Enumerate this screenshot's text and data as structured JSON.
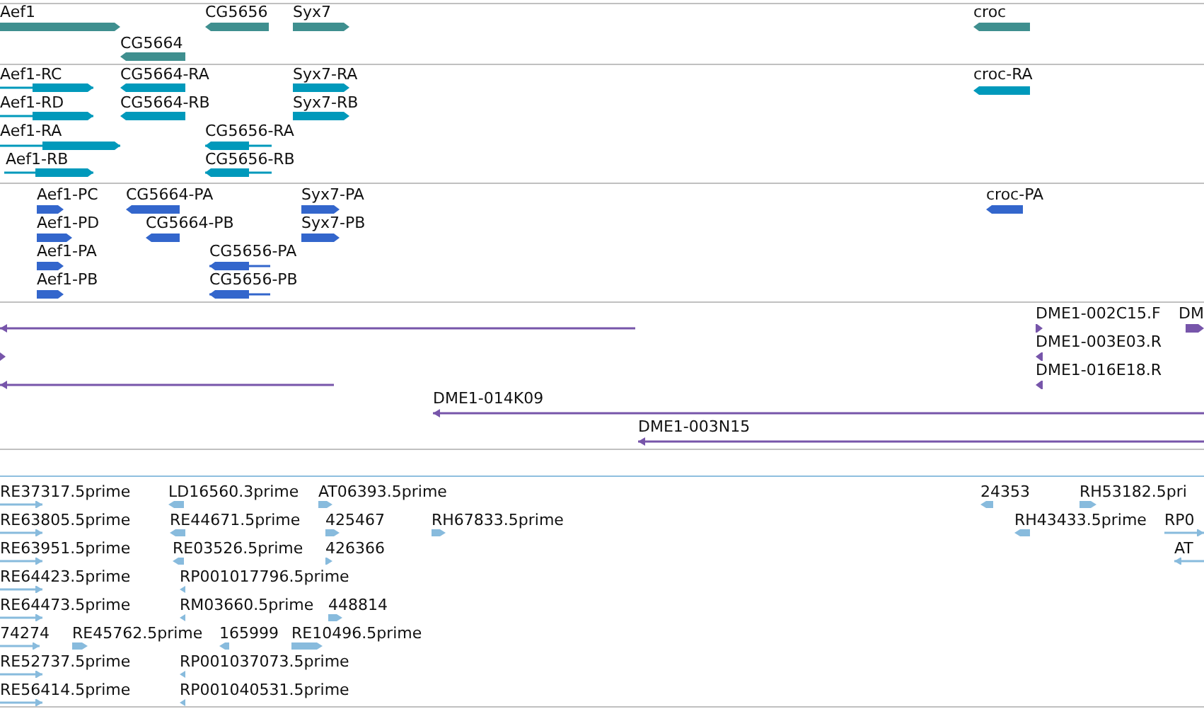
{
  "tracks": [
    {
      "color": "#3f8f8f",
      "features": [
        {
          "label": "Aef1",
          "reverse": false
        },
        {
          "label": "CG5664",
          "reverse": true
        },
        {
          "label": "CG5656",
          "reverse": true
        },
        {
          "label": "Syx7",
          "reverse": false
        },
        {
          "label": "croc",
          "reverse": true
        }
      ]
    },
    {
      "color": "#0099bb",
      "features": [
        {
          "label": "Aef1-RC",
          "reverse": false
        },
        {
          "label": "Aef1-RD",
          "reverse": false
        },
        {
          "label": "Aef1-RA",
          "reverse": false
        },
        {
          "label": "Aef1-RB",
          "reverse": false
        },
        {
          "label": "CG5664-RA",
          "reverse": true
        },
        {
          "label": "CG5664-RB",
          "reverse": true
        },
        {
          "label": "Syx7-RA",
          "reverse": false
        },
        {
          "label": "Syx7-RB",
          "reverse": false
        },
        {
          "label": "CG5656-RA",
          "reverse": true
        },
        {
          "label": "CG5656-RB",
          "reverse": true
        },
        {
          "label": "croc-RA",
          "reverse": true
        }
      ]
    },
    {
      "color": "#3366cc",
      "features": [
        {
          "label": "Aef1-PC",
          "reverse": false
        },
        {
          "label": "Aef1-PD",
          "reverse": false
        },
        {
          "label": "Aef1-PA",
          "reverse": false
        },
        {
          "label": "Aef1-PB",
          "reverse": false
        },
        {
          "label": "CG5664-PA",
          "reverse": true
        },
        {
          "label": "CG5664-PB",
          "reverse": true
        },
        {
          "label": "Syx7-PA",
          "reverse": false
        },
        {
          "label": "Syx7-PB",
          "reverse": false
        },
        {
          "label": "CG5656-PA",
          "reverse": true
        },
        {
          "label": "CG5656-PB",
          "reverse": true
        },
        {
          "label": "croc-PA",
          "reverse": true
        }
      ]
    },
    {
      "color": "#7755aa",
      "features": [
        {
          "reverse": true
        },
        {
          "reverse": false
        },
        {
          "reverse": true
        },
        {
          "label": "DME1-014K09",
          "reverse": true
        },
        {
          "label": "DME1-003N15",
          "reverse": true
        },
        {
          "label": "DME1-002C15.F",
          "reverse": false
        },
        {
          "label": "DM",
          "reverse": false
        },
        {
          "label": "DME1-003E03.R",
          "reverse": true
        },
        {
          "label": "DME1-016E18.R",
          "reverse": true
        }
      ]
    },
    {
      "color": "#88bbdd",
      "features": [
        {
          "label": "RE37317.5prime",
          "reverse": false
        },
        {
          "label": "LD16560.3prime",
          "reverse": true
        },
        {
          "label": "AT06393.5prime",
          "reverse": false
        },
        {
          "label": "24353",
          "reverse": true
        },
        {
          "label": "RH53182.5pri",
          "reverse": false
        },
        {
          "label": "RE63805.5prime",
          "reverse": false
        },
        {
          "label": "RE44671.5prime",
          "reverse": true
        },
        {
          "label": "425467",
          "reverse": false
        },
        {
          "label": "RH67833.5prime",
          "reverse": false
        },
        {
          "label": "RH43433.5prime",
          "reverse": true
        },
        {
          "label": "RP0",
          "reverse": false
        },
        {
          "label": "RE63951.5prime",
          "reverse": false
        },
        {
          "label": "RE03526.5prime",
          "reverse": true
        },
        {
          "label": "426366",
          "reverse": false
        },
        {
          "label": "AT",
          "reverse": true
        },
        {
          "label": "RE64423.5prime",
          "reverse": false
        },
        {
          "label": "RP001017796.5prime",
          "reverse": true
        },
        {
          "label": "RE64473.5prime",
          "reverse": false
        },
        {
          "label": "RM03660.5prime",
          "reverse": true
        },
        {
          "label": "448814",
          "reverse": false
        },
        {
          "label": "74274",
          "reverse": false
        },
        {
          "label": "RE45762.5prime",
          "reverse": false
        },
        {
          "label": "165999",
          "reverse": true
        },
        {
          "label": "RE10496.5prime",
          "reverse": false
        },
        {
          "label": "RE52737.5prime",
          "reverse": false
        },
        {
          "label": "RP001037073.5prime",
          "reverse": true
        },
        {
          "label": "RE56414.5prime",
          "reverse": false
        },
        {
          "label": "RP001040531.5prime",
          "reverse": true
        }
      ]
    }
  ]
}
